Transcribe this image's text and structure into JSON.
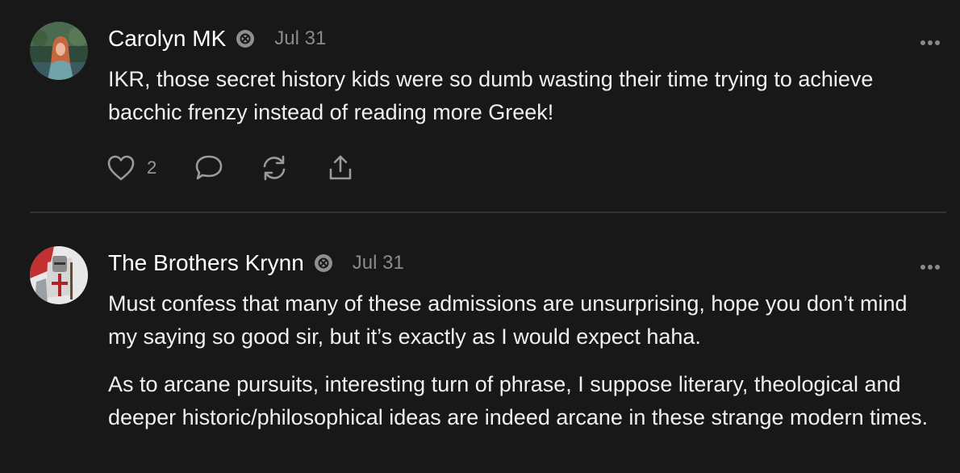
{
  "comments": [
    {
      "author": "Carolyn MK",
      "date": "Jul 31",
      "paragraphs": [
        "IKR, those secret history kids were so dumb wasting their time trying to achieve bacchic frenzy instead of reading more Greek!"
      ],
      "likes": "2"
    },
    {
      "author": "The Brothers Krynn",
      "date": "Jul 31",
      "paragraphs": [
        "Must confess that many of these admissions are unsurprising, hope you don’t mind my saying so good sir, but it’s exactly as I would expect haha.",
        "As to arcane pursuits, interesting turn of phrase, I suppose literary, theological and deeper historic/philosophical ideas are indeed arcane in these strange modern times."
      ]
    }
  ],
  "icons": {
    "badge": "subscriber-badge-icon",
    "more": "more-options-icon",
    "like": "heart-icon",
    "reply": "comment-bubble-icon",
    "restack": "restack-icon",
    "share": "share-icon"
  },
  "colors": {
    "background": "#181818",
    "text": "#f2f2f2",
    "muted": "#8a8a8a",
    "divider": "#333333"
  }
}
